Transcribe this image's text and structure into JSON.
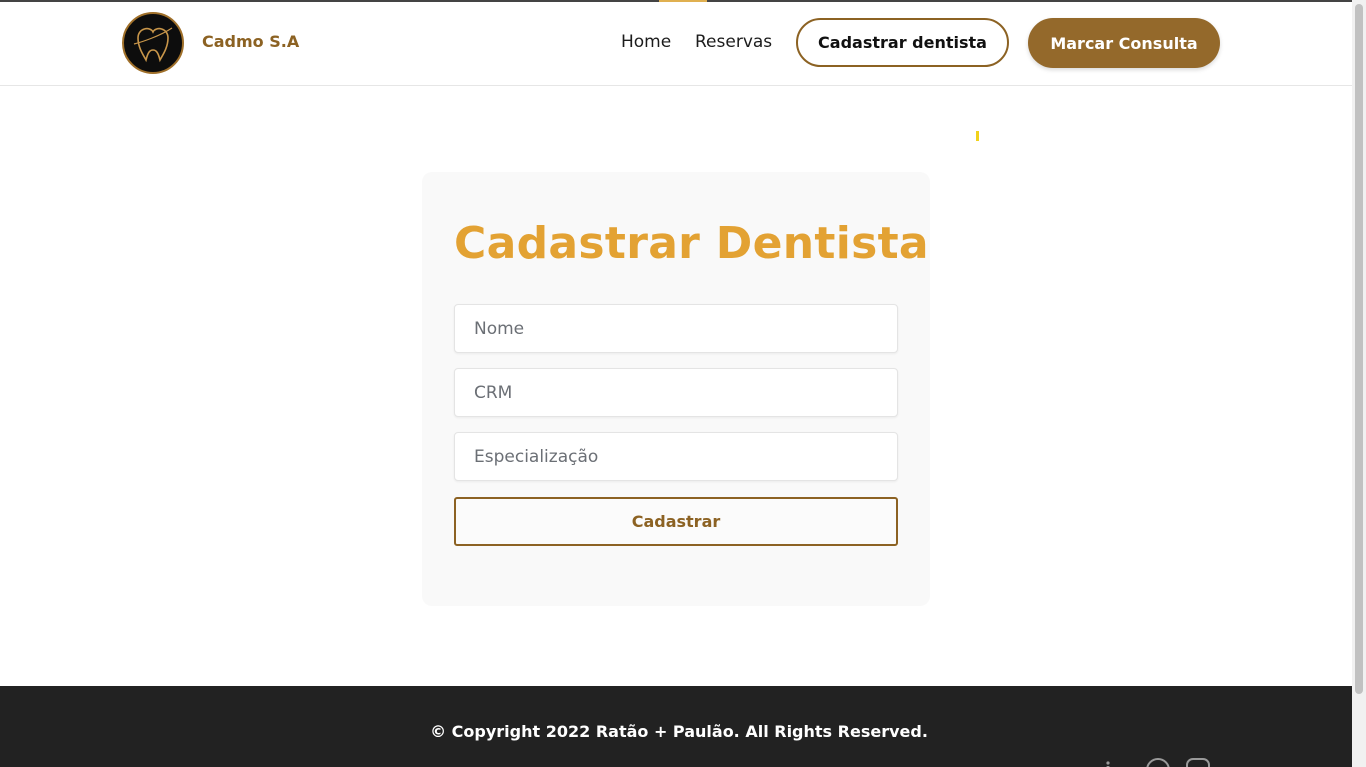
{
  "header": {
    "brand": "Cadmo S.A",
    "logo_icon": "tooth-logo-icon",
    "nav": [
      {
        "label": "Home"
      },
      {
        "label": "Reservas"
      }
    ],
    "cadastrar_dentista_label": "Cadastrar dentista",
    "marcar_consulta_label": "Marcar Consulta"
  },
  "form": {
    "title": "Cadastrar Dentista",
    "fields": [
      {
        "placeholder": "Nome",
        "value": ""
      },
      {
        "placeholder": "CRM",
        "value": ""
      },
      {
        "placeholder": "Especialização",
        "value": ""
      }
    ],
    "submit_label": "Cadastrar"
  },
  "footer": {
    "copyright": "© Copyright 2022 Ratão + Paulão. All Rights Reserved.",
    "social_icons": [
      "linkedin-icon",
      "whatsapp-icon",
      "instagram-icon"
    ]
  },
  "colors": {
    "accent": "#94692b",
    "title": "#e3a233",
    "footer_bg": "#222222"
  }
}
